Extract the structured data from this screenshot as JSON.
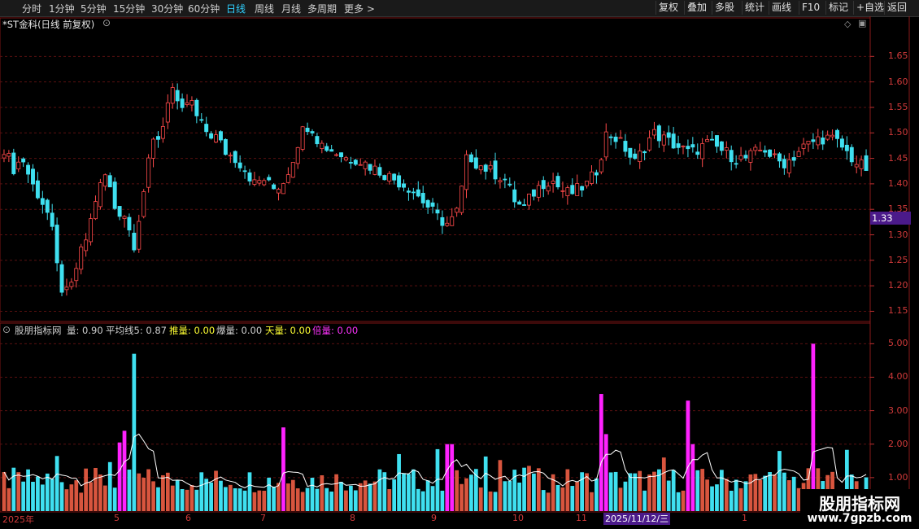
{
  "toolbar": {
    "periods": [
      "分时",
      "1分钟",
      "5分钟",
      "15分钟",
      "30分钟",
      "60分钟",
      "日线",
      "周线",
      "月线",
      "多周期",
      "更多 >"
    ],
    "active": "日线",
    "right_buttons": [
      "复权",
      "叠加",
      "多股",
      "统计",
      "画线",
      "F10",
      "标记",
      "+自选",
      "返回"
    ]
  },
  "chart_header": {
    "title": "*ST金科(日线 前复权)"
  },
  "price_axis": {
    "labels": [
      "1.65",
      "1.60",
      "1.55",
      "1.50",
      "1.45",
      "1.40",
      "1.35",
      "1.30",
      "1.25",
      "1.20",
      "1.15"
    ],
    "current_price": "1.33"
  },
  "indicator_header": {
    "name": "股朋指标网",
    "items": [
      {
        "label": "量: 0.90",
        "color": "#d0d0d0"
      },
      {
        "label": "平均线5: 0.87",
        "color": "#d0d0d0"
      },
      {
        "label": "推量: 0.00",
        "color": "#ffff33"
      },
      {
        "label": "爆量: 0.00",
        "color": "#d0d0d0"
      },
      {
        "label": "天量: 0.00",
        "color": "#ffff33"
      },
      {
        "label": "倍量: 0.00",
        "color": "#ff33ff"
      }
    ]
  },
  "volume_axis": {
    "labels": [
      "5.00",
      "4.00",
      "3.00",
      "2.00",
      "1.00"
    ]
  },
  "date_axis": {
    "labels": [
      "2025年",
      "5",
      "6",
      "7",
      "8",
      "9",
      "10",
      "11",
      "1"
    ],
    "cursor_date": "2025/11/12/三"
  },
  "watermark": {
    "title": "股朋指标网",
    "url": "www.7gpzb.com"
  },
  "colors": {
    "up": "#ff4a4a",
    "down": "#3fe0f0",
    "highlight": "#ff22ff",
    "grid": "#5a1010",
    "axis": "#c03030",
    "accent_current": "#4b1a8a"
  },
  "chart_data": [
    {
      "type": "candlestick",
      "title": "*ST金科(日线 前复权)",
      "ylim": [
        1.13,
        1.7
      ],
      "note_series_count": 180,
      "close_path": [
        1.47,
        1.43,
        1.45,
        1.4,
        1.37,
        1.33,
        1.2,
        1.18,
        1.25,
        1.3,
        1.38,
        1.42,
        1.35,
        1.34,
        1.28,
        1.38,
        1.48,
        1.5,
        1.6,
        1.53,
        1.57,
        1.52,
        1.5,
        1.49,
        1.46,
        1.45,
        1.43,
        1.4,
        1.41,
        1.39,
        1.4,
        1.44,
        1.5,
        1.52,
        1.48,
        1.47,
        1.46,
        1.45,
        1.45,
        1.44,
        1.43,
        1.42,
        1.41,
        1.4,
        1.39,
        1.37,
        1.35,
        1.33,
        1.32,
        1.35,
        1.46,
        1.44,
        1.43,
        1.42,
        1.41,
        1.37,
        1.35,
        1.38,
        1.4,
        1.41,
        1.39,
        1.38,
        1.39,
        1.4,
        1.43,
        1.5,
        1.49,
        1.47,
        1.44,
        1.47,
        1.5,
        1.49,
        1.48,
        1.47,
        1.46,
        1.47,
        1.48,
        1.47,
        1.46,
        1.45,
        1.45,
        1.46,
        1.47,
        1.45,
        1.44,
        1.45,
        1.47,
        1.48,
        1.49,
        1.49,
        1.48,
        1.46,
        1.44,
        1.43
      ]
    },
    {
      "type": "bar",
      "title": "股朋指标网",
      "ylim": [
        0,
        5.3
      ],
      "series": [
        {
          "name": "量"
        },
        {
          "name": "平均线5"
        }
      ]
    }
  ]
}
